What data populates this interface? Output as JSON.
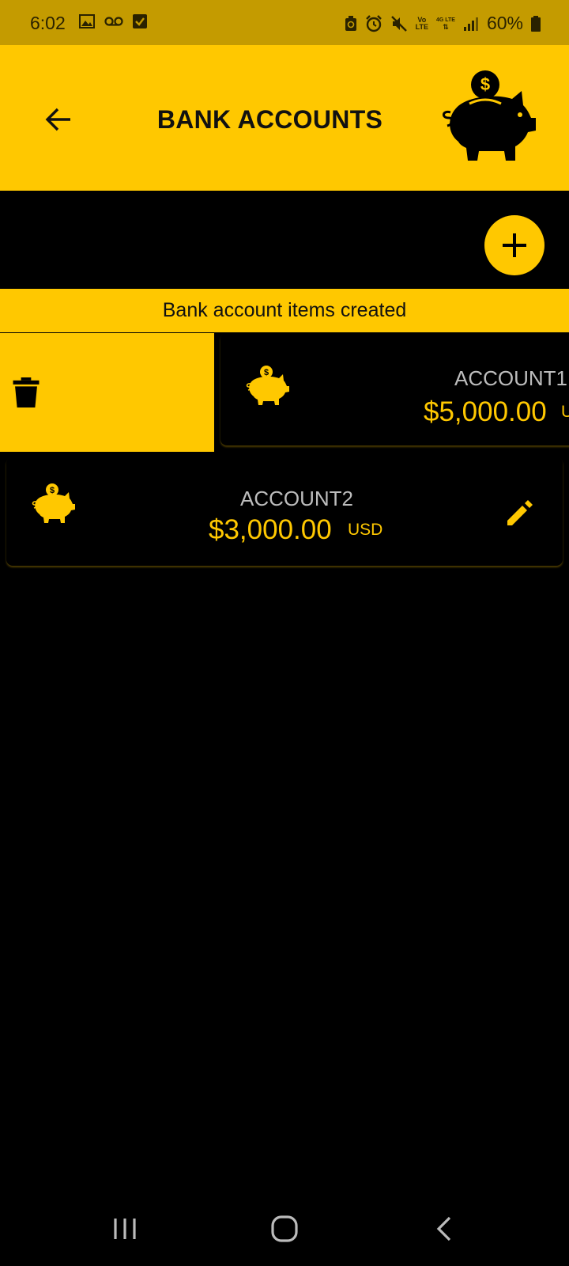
{
  "status_bar": {
    "time": "6:02",
    "battery_percent": "60%",
    "net_top": "Vo",
    "net_bottom": "LTE",
    "net_4g": "4G LTE",
    "icons_left": [
      "image-icon",
      "voicemail-icon",
      "checkbox-icon"
    ],
    "icons_right": [
      "recycle-icon",
      "alarm-icon",
      "mute-icon",
      "volte-icon",
      "4g-icon",
      "signal-icon",
      "battery-icon"
    ]
  },
  "header": {
    "title": "BANK ACCOUNTS",
    "back_icon": "arrow-left-icon",
    "logo_icon": "piggy-bank-icon"
  },
  "fab": {
    "icon": "plus-icon"
  },
  "banner": {
    "text": "Bank account items created"
  },
  "accounts": [
    {
      "name": "ACCOUNT1",
      "amount": "$5,000.00",
      "currency": "USD",
      "swiped": true
    },
    {
      "name": "ACCOUNT2",
      "amount": "$3,000.00",
      "currency": "USD",
      "swiped": false
    }
  ],
  "actions": {
    "delete_icon": "trash-icon",
    "edit_icon": "pencil-icon"
  },
  "nav_bar": {
    "icons": [
      "recent-apps-icon",
      "home-icon",
      "back-icon"
    ]
  },
  "colors": {
    "accent": "#FFC800",
    "status_bar": "#C49B00",
    "background": "#000000",
    "text_secondary": "#BDBDBD"
  }
}
